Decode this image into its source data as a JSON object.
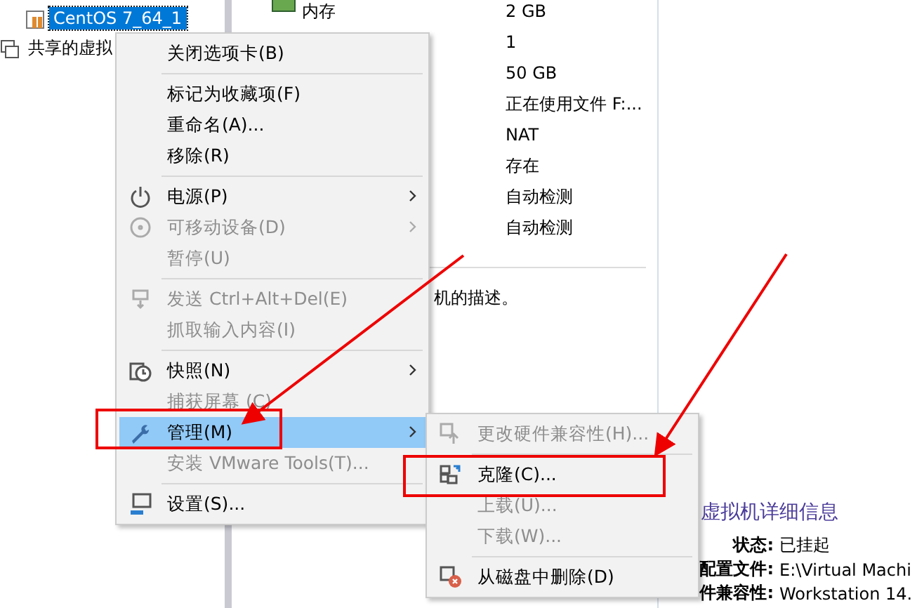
{
  "sidebar": {
    "items": [
      {
        "label": "CentOS 7_64_1",
        "selected": true
      },
      {
        "label": "共享的虚拟",
        "selected": false
      }
    ]
  },
  "devices": {
    "label": "内存",
    "values": [
      "2 GB",
      "1",
      "50 GB",
      "正在使用文件 F:...",
      "NAT",
      "存在",
      "自动检测",
      "自动检测"
    ]
  },
  "description": "机的描述。",
  "details": {
    "title": "虚拟机详细信息",
    "rows": [
      {
        "label": "状态:",
        "value": "已挂起"
      },
      {
        "label": "配置文件:",
        "value": "E:\\Virtual Machi"
      },
      {
        "label": "件兼容性:",
        "value": "Workstation 14."
      }
    ]
  },
  "context_menu": {
    "items": [
      {
        "kind": "item",
        "label": "关闭选项卡(B)",
        "disabled": false,
        "selected": false,
        "submenu": false
      },
      {
        "kind": "separator"
      },
      {
        "kind": "item",
        "label": "标记为收藏项(F)",
        "disabled": false,
        "selected": false,
        "submenu": false
      },
      {
        "kind": "item",
        "label": "重命名(A)...",
        "disabled": false,
        "selected": false,
        "submenu": false
      },
      {
        "kind": "item",
        "label": "移除(R)",
        "disabled": false,
        "selected": false,
        "submenu": false
      },
      {
        "kind": "separator"
      },
      {
        "kind": "item",
        "label": "电源(P)",
        "disabled": false,
        "selected": false,
        "submenu": true
      },
      {
        "kind": "item",
        "label": "可移动设备(D)",
        "disabled": true,
        "selected": false,
        "submenu": true
      },
      {
        "kind": "item",
        "label": "暂停(U)",
        "disabled": true,
        "selected": false,
        "submenu": false
      },
      {
        "kind": "separator"
      },
      {
        "kind": "item",
        "label": "发送 Ctrl+Alt+Del(E)",
        "disabled": true,
        "selected": false,
        "submenu": false
      },
      {
        "kind": "item",
        "label": "抓取输入内容(I)",
        "disabled": true,
        "selected": false,
        "submenu": false
      },
      {
        "kind": "separator"
      },
      {
        "kind": "item",
        "label": "快照(N)",
        "disabled": false,
        "selected": false,
        "submenu": true
      },
      {
        "kind": "item",
        "label": "捕获屏幕 (C)",
        "disabled": true,
        "selected": false,
        "submenu": false
      },
      {
        "kind": "item",
        "label": "管理(M)",
        "disabled": false,
        "selected": true,
        "submenu": true
      },
      {
        "kind": "item",
        "label": "安装 VMware Tools(T)...",
        "disabled": true,
        "selected": false,
        "submenu": false
      },
      {
        "kind": "separator"
      },
      {
        "kind": "item",
        "label": "设置(S)...",
        "disabled": false,
        "selected": false,
        "submenu": false
      }
    ]
  },
  "submenu": {
    "items": [
      {
        "kind": "item",
        "label": "更改硬件兼容性(H)...",
        "disabled": true,
        "selected": false
      },
      {
        "kind": "separator"
      },
      {
        "kind": "item",
        "label": "克隆(C)...",
        "disabled": false,
        "selected": false
      },
      {
        "kind": "item",
        "label": "上载(U)...",
        "disabled": true,
        "selected": false
      },
      {
        "kind": "item",
        "label": "下载(W)...",
        "disabled": true,
        "selected": false
      },
      {
        "kind": "separator"
      },
      {
        "kind": "item",
        "label": "从磁盘中删除(D)",
        "disabled": false,
        "selected": false
      }
    ]
  }
}
